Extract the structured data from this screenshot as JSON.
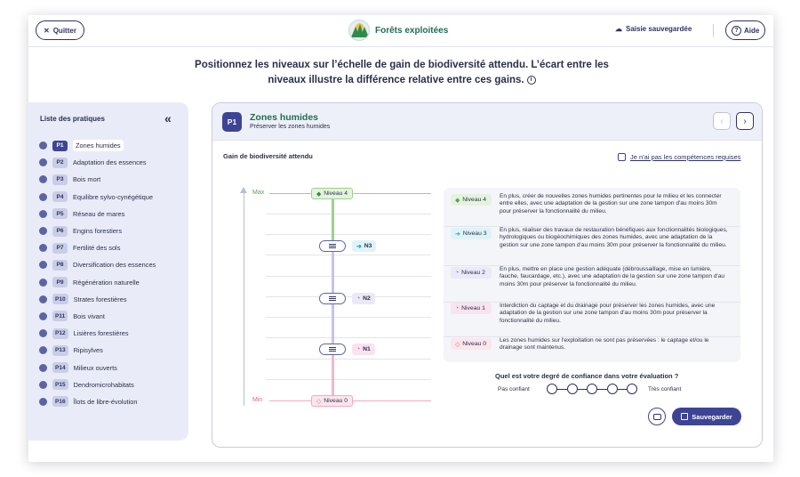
{
  "header": {
    "quit_label": "Quitter",
    "app_title": "Forêts exploitées",
    "saved_label": "Saisie sauvegardée",
    "help_label": "Aide"
  },
  "instruction": {
    "line1": "Positionnez les niveaux sur l’échelle de gain de biodiversité attendu. L’écart entre les",
    "line2": "niveaux illustre la différence relative entre ces gains."
  },
  "sidebar": {
    "title": "Liste des pratiques",
    "items": [
      {
        "code": "P1",
        "label": "Zones humides",
        "active": true
      },
      {
        "code": "P2",
        "label": "Adaptation des essences"
      },
      {
        "code": "P3",
        "label": "Bois mort"
      },
      {
        "code": "P4",
        "label": "Equilibre sylvo-cynégétique"
      },
      {
        "code": "P5",
        "label": "Réseau de mares"
      },
      {
        "code": "P6",
        "label": "Engins forestiers"
      },
      {
        "code": "P7",
        "label": "Fertilité des sols"
      },
      {
        "code": "P8",
        "label": "Diversification des essences"
      },
      {
        "code": "P9",
        "label": "Régénération naturelle"
      },
      {
        "code": "P10",
        "label": "Strates forestières"
      },
      {
        "code": "P11",
        "label": "Bois vivant"
      },
      {
        "code": "P12",
        "label": "Lisières forestières"
      },
      {
        "code": "P13",
        "label": "Ripisylves"
      },
      {
        "code": "P14",
        "label": "Milieux ouverts"
      },
      {
        "code": "P15",
        "label": "Dendromicrohabitats"
      },
      {
        "code": "P16",
        "label": "Îlots de libre-évolution"
      }
    ]
  },
  "practice": {
    "code": "P1",
    "title": "Zones humides",
    "subtitle": "Préserver les zones humides",
    "gain_label": "Gain de biodiversité attendu",
    "no_competence_label": "Je n'ai pas les compétences requises"
  },
  "scale": {
    "max_label": "Max",
    "min_label": "Min",
    "top_level": "Niveau 4",
    "bottom_level": "Niveau 0",
    "n3": "N3",
    "n2": "N2",
    "n1": "N1"
  },
  "levels": [
    {
      "badge": "Niveau 4",
      "color": "#52a648",
      "bg": "#e4f3df",
      "glyph": "◆",
      "text": "En plus, créer de nouvelles zones humides pertinentes pour le milieu et les connecter entre elles, avec une adaptation de la gestion sur une zone tampon d'au moins 30m pour préserver la fonctionnalité du milieu."
    },
    {
      "badge": "Niveau 3",
      "color": "#1aa3b8",
      "bg": "#dff3f7",
      "glyph": "➔",
      "text": "En plus, réaliser des travaux de restauration bénéfiques aux fonctionnalités biologiques, hydrologiques ou biogéochimiques des zones humides, avec une adaptation de la gestion sur une zone tampon d'au moins 30m pour préserver la fonctionnalité du milieu."
    },
    {
      "badge": "Niveau 2",
      "color": "#6c63c7",
      "bg": "#ebe9f8",
      "glyph": "◔",
      "text": "En plus, mettre en place une gestion adéquate (débroussaillage, mise en lumière, fauche, faucardage, etc.), avec une adaptation de la gestion sur une zone tampon d'au moins 30m pour préserver la fonctionnalité du milieu."
    },
    {
      "badge": "Niveau 1",
      "color": "#d04c94",
      "bg": "#f8e3ef",
      "glyph": "◔",
      "text": "Interdiction du captage et du drainage pour préserver les zones humides, avec une adaptation de la gestion sur une zone tampon d'au moins 30m pour préserver la fonctionnalité du milieu."
    },
    {
      "badge": "Niveau 0",
      "color": "#e0628a",
      "bg": "#fbe6ee",
      "glyph": "◇",
      "text": "Les zones humides sur l'exploitation ne sont pas préservées : le captage et/ou le drainage sont maintenus."
    }
  ],
  "confidence": {
    "question": "Quel est votre degré de confiance dans votre évaluation ?",
    "left_label": "Pas confiant",
    "right_label": "Très confiant"
  },
  "actions": {
    "save_label": "Sauvegarder"
  },
  "colors": {
    "primary": "#3e4494",
    "green": "#1f6e4f",
    "sidebar_bg": "#e9ecf8"
  }
}
